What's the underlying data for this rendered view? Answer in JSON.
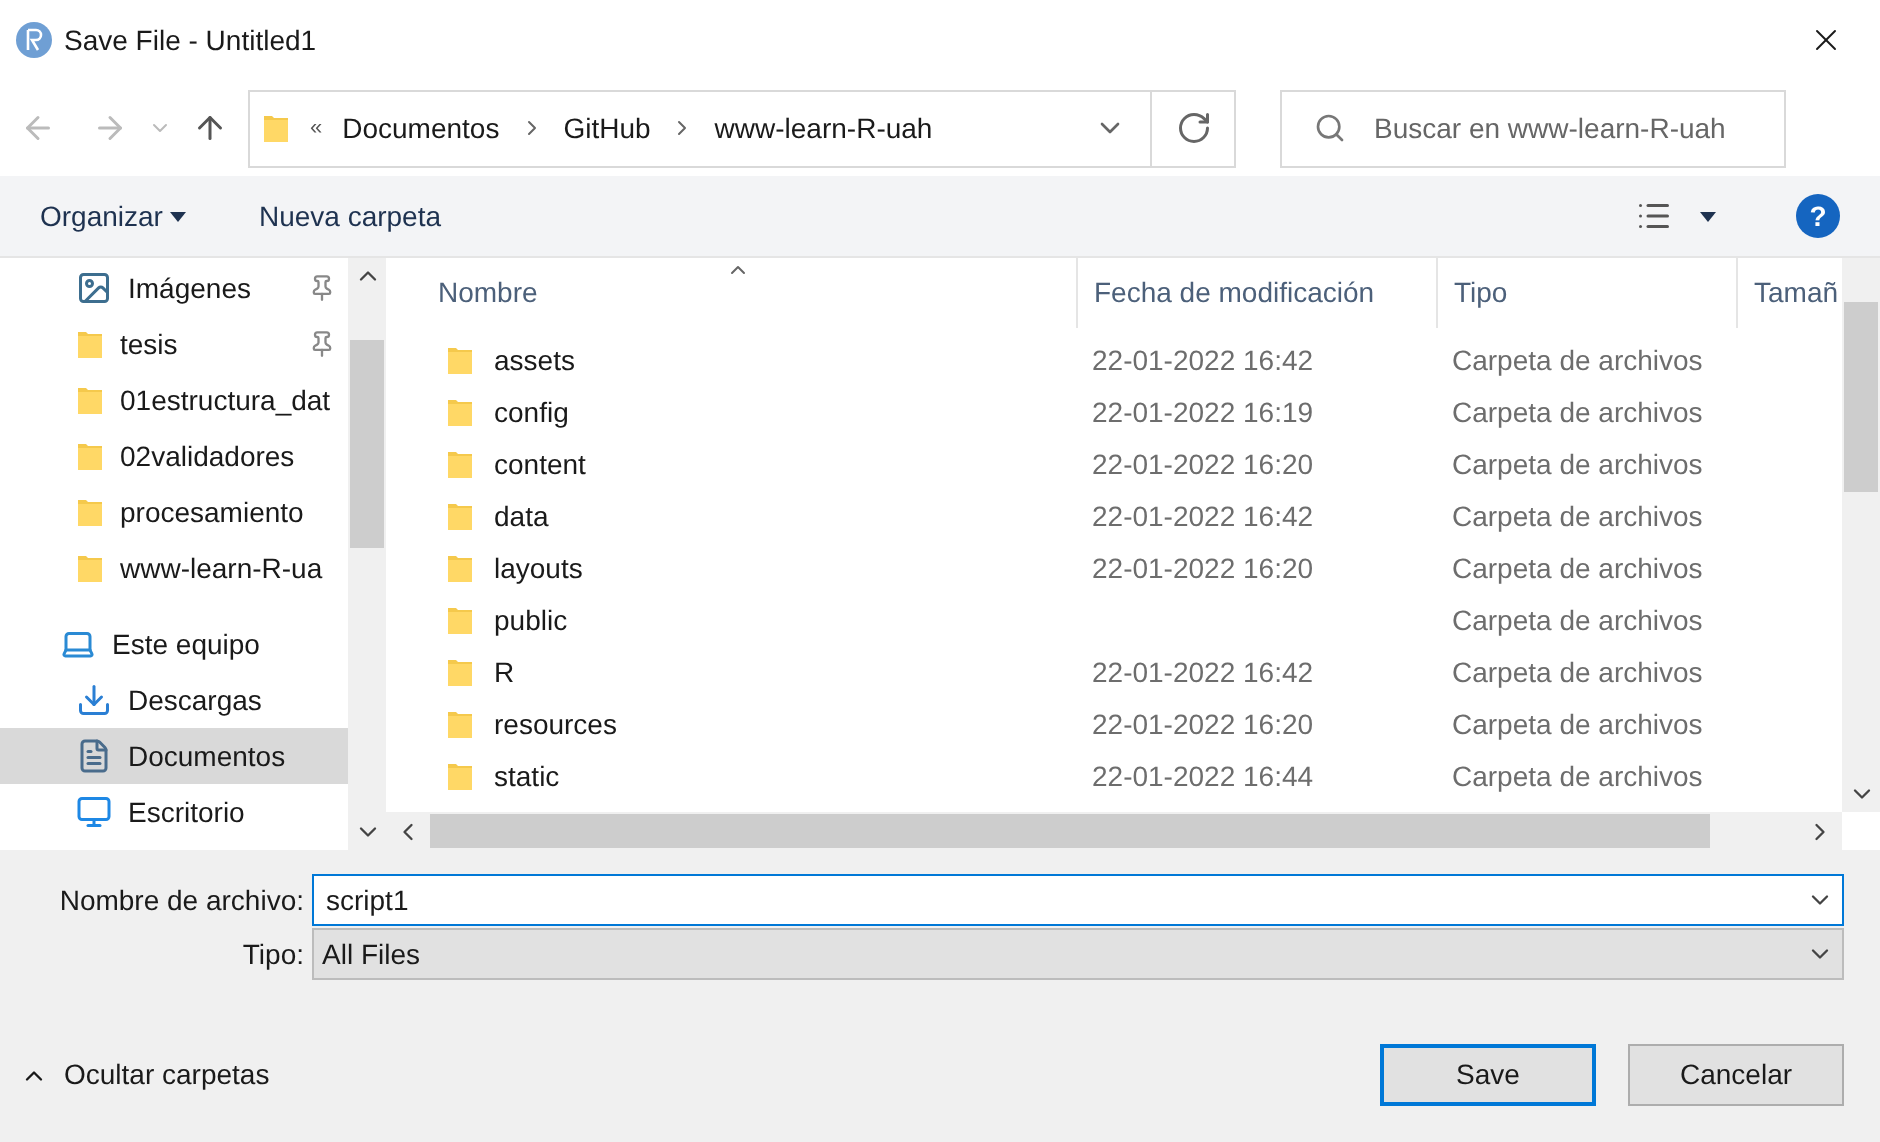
{
  "window": {
    "title": "Save File - Untitled1"
  },
  "address_bar": {
    "overflow": "«",
    "path": [
      "Documentos",
      "GitHub",
      "www-learn-R-uah"
    ]
  },
  "search": {
    "placeholder": "Buscar en www-learn-R-uah"
  },
  "toolbar": {
    "organize": "Organizar",
    "new_folder": "Nueva carpeta",
    "help": "?"
  },
  "sidebar": {
    "items": [
      {
        "label": "Imágenes",
        "kind": "pictures",
        "pinned": true,
        "selected": false
      },
      {
        "label": "tesis",
        "kind": "folder",
        "pinned": true,
        "selected": false
      },
      {
        "label": "01estructura_dat",
        "kind": "folder",
        "pinned": false,
        "selected": false
      },
      {
        "label": "02validadores",
        "kind": "folder",
        "pinned": false,
        "selected": false
      },
      {
        "label": "procesamiento",
        "kind": "folder",
        "pinned": false,
        "selected": false
      },
      {
        "label": "www-learn-R-ua",
        "kind": "folder",
        "pinned": false,
        "selected": false
      },
      {
        "label": "Este equipo",
        "kind": "computer",
        "pinned": false,
        "selected": false
      },
      {
        "label": "Descargas",
        "kind": "download",
        "pinned": false,
        "selected": false
      },
      {
        "label": "Documentos",
        "kind": "document",
        "pinned": false,
        "selected": true
      },
      {
        "label": "Escritorio",
        "kind": "desktop",
        "pinned": false,
        "selected": false
      }
    ]
  },
  "table": {
    "columns": [
      "Nombre",
      "Fecha de modificación",
      "Tipo",
      "Tamañ"
    ],
    "rows": [
      {
        "name": "assets",
        "date": "22-01-2022 16:42",
        "type": "Carpeta de archivos"
      },
      {
        "name": "config",
        "date": "22-01-2022 16:19",
        "type": "Carpeta de archivos"
      },
      {
        "name": "content",
        "date": "22-01-2022 16:20",
        "type": "Carpeta de archivos"
      },
      {
        "name": "data",
        "date": "22-01-2022 16:42",
        "type": "Carpeta de archivos"
      },
      {
        "name": "layouts",
        "date": "22-01-2022 16:20",
        "type": "Carpeta de archivos"
      },
      {
        "name": "public",
        "date": "",
        "type": "Carpeta de archivos"
      },
      {
        "name": "R",
        "date": "22-01-2022 16:42",
        "type": "Carpeta de archivos"
      },
      {
        "name": "resources",
        "date": "22-01-2022 16:20",
        "type": "Carpeta de archivos"
      },
      {
        "name": "static",
        "date": "22-01-2022 16:44",
        "type": "Carpeta de archivos"
      }
    ]
  },
  "file_name": {
    "label": "Nombre de archivo:",
    "value": "script1"
  },
  "file_type": {
    "label": "Tipo:",
    "value": "All Files"
  },
  "hide_folders": "Ocultar carpetas",
  "buttons": {
    "save": "Save",
    "cancel": "Cancelar"
  }
}
